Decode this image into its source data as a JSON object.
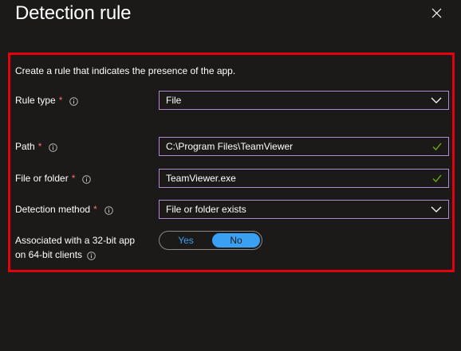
{
  "header": {
    "title": "Detection rule",
    "close_icon": "close-icon"
  },
  "form": {
    "description": "Create a rule that indicates the presence of the app.",
    "required_marker": "*",
    "rule_type": {
      "label": "Rule type",
      "value": "File"
    },
    "path": {
      "label": "Path",
      "value": "C:\\Program Files\\TeamViewer"
    },
    "file_or_folder": {
      "label": "File or folder",
      "value": "TeamViewer.exe"
    },
    "detection_method": {
      "label": "Detection method",
      "value": "File or folder exists"
    },
    "associated_32bit": {
      "label_line1": "Associated with a 32-bit app",
      "label_line2": "on 64-bit clients",
      "option_yes": "Yes",
      "option_no": "No",
      "selected": "No"
    }
  },
  "colors": {
    "background": "#1b1a19",
    "highlight_border": "#e3000f",
    "field_border": "#b18ad6",
    "required": "#f1707b",
    "accent": "#3aa0f3",
    "valid_check": "#6bb700"
  }
}
